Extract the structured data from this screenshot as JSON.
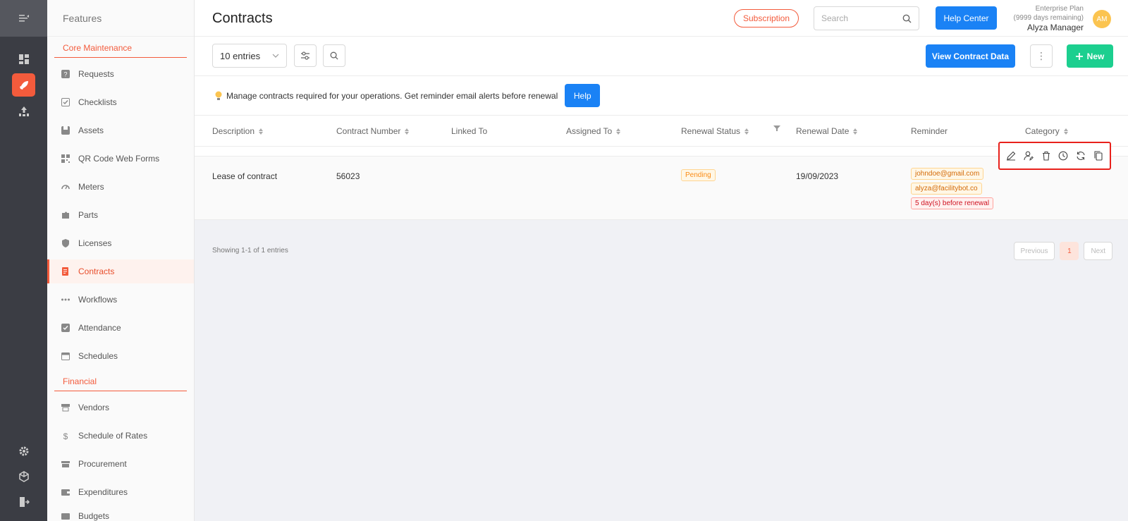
{
  "sidebar": {
    "title": "Features",
    "sections": [
      {
        "title": "Core Maintenance"
      },
      {
        "title": "Financial"
      }
    ],
    "items": [
      {
        "label": "Requests",
        "icon": "question-icon"
      },
      {
        "label": "Checklists",
        "icon": "checklist-icon"
      },
      {
        "label": "Assets",
        "icon": "assets-icon"
      },
      {
        "label": "QR Code Web Forms",
        "icon": "qr-icon"
      },
      {
        "label": "Meters",
        "icon": "gauge-icon"
      },
      {
        "label": "Parts",
        "icon": "puzzle-icon"
      },
      {
        "label": "Licenses",
        "icon": "shield-icon"
      },
      {
        "label": "Contracts",
        "icon": "contract-icon"
      },
      {
        "label": "Workflows",
        "icon": "dots-icon"
      },
      {
        "label": "Attendance",
        "icon": "check-square-icon"
      },
      {
        "label": "Schedules",
        "icon": "calendar-icon"
      },
      {
        "label": "Vendors",
        "icon": "store-icon"
      },
      {
        "label": "Schedule of Rates",
        "icon": "dollar-icon"
      },
      {
        "label": "Procurement",
        "icon": "shop-icon"
      },
      {
        "label": "Expenditures",
        "icon": "wallet-icon"
      },
      {
        "label": "Budgets",
        "icon": "budget-icon"
      }
    ]
  },
  "header": {
    "title": "Contracts",
    "subscription_label": "Subscription",
    "search_placeholder": "Search",
    "help_center_label": "Help Center",
    "plan_name": "Enterprise Plan",
    "plan_days": "(9999 days remaining)",
    "user_name": "Alyza Manager",
    "avatar_initials": "AM"
  },
  "toolbar": {
    "entries_label": "10 entries",
    "view_contract_label": "View Contract Data",
    "more_label": "⋮",
    "new_label": "New"
  },
  "info": {
    "message": "Manage contracts required for your operations. Get reminder email alerts before renewal",
    "help_label": "Help"
  },
  "table": {
    "columns": [
      "Description",
      "Contract Number",
      "Linked To",
      "Assigned To",
      "Renewal Status",
      "Renewal Date",
      "Reminder",
      "Category"
    ],
    "rows": [
      {
        "description": "Lease of contract",
        "contract_number": "56023",
        "linked_to": "",
        "assigned_to": "",
        "renewal_status": "Pending",
        "renewal_date": "19/09/2023",
        "reminder_emails": [
          "johndoe@gmail.com",
          "alyza@facilitybot.co"
        ],
        "reminder_days": "5 day(s) before renewal",
        "category": ""
      }
    ]
  },
  "footer": {
    "showing": "Showing 1-1 of 1 entries",
    "prev_label": "Previous",
    "current_page": "1",
    "next_label": "Next"
  },
  "colors": {
    "accent": "#f35b3c",
    "primary": "#1a82f5",
    "success": "#1ccf8f"
  }
}
